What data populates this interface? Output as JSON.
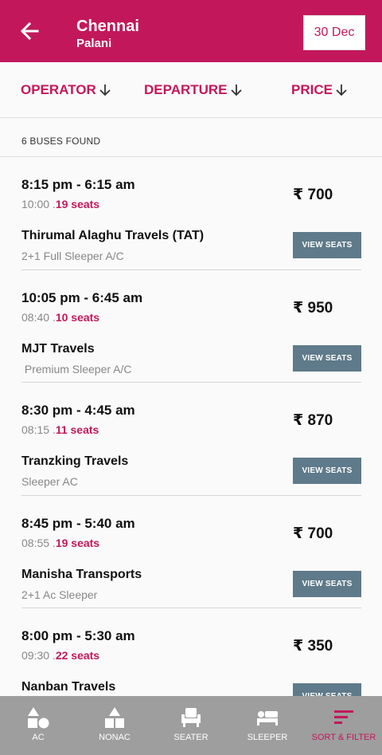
{
  "header": {
    "title": "Chennai",
    "subtitle": "Palani",
    "date": "30 Dec"
  },
  "sort": {
    "operator": "OPERATOR",
    "departure": "DEPARTURE",
    "price": "PRICE"
  },
  "results_count": "6 BUSES FOUND",
  "buses": [
    {
      "time": "8:15 pm - 6:15 am",
      "duration": "10:00 .",
      "seats": "19 seats",
      "price": "₹ 700",
      "name": "Thirumal Alaghu Travels (TAT)",
      "type": "2+1 Full Sleeper A/C",
      "button": "VIEW SEATS"
    },
    {
      "time": "10:05 pm - 6:45 am",
      "duration": "08:40 .",
      "seats": "10 seats",
      "price": "₹ 950",
      "name": "MJT Travels",
      "type": " Premium Sleeper A/C",
      "button": "VIEW SEATS"
    },
    {
      "time": "8:30 pm - 4:45 am",
      "duration": "08:15 .",
      "seats": "11 seats",
      "price": "₹ 870",
      "name": "Tranzking Travels",
      "type": "Sleeper AC",
      "button": "VIEW SEATS"
    },
    {
      "time": "8:45 pm - 5:40 am",
      "duration": "08:55 .",
      "seats": "19 seats",
      "price": "₹ 700",
      "name": "Manisha Transports",
      "type": "2+1 Ac Sleeper",
      "button": "VIEW SEATS"
    },
    {
      "time": "8:00 pm - 5:30 am",
      "duration": "09:30 .",
      "seats": "22 seats",
      "price": "₹ 350",
      "name": "Nanban Travels",
      "type": "",
      "button": "VIEW SEATS"
    }
  ],
  "bottom_nav": {
    "ac": "AC",
    "nonac": "NONAC",
    "seater": "SEATER",
    "sleeper": "SLEEPER",
    "sort_filter": "SORT & FILTER"
  },
  "colors": {
    "primary": "#c2185b",
    "button": "#5f7a8a",
    "nav_bg": "#9e9e9e"
  }
}
